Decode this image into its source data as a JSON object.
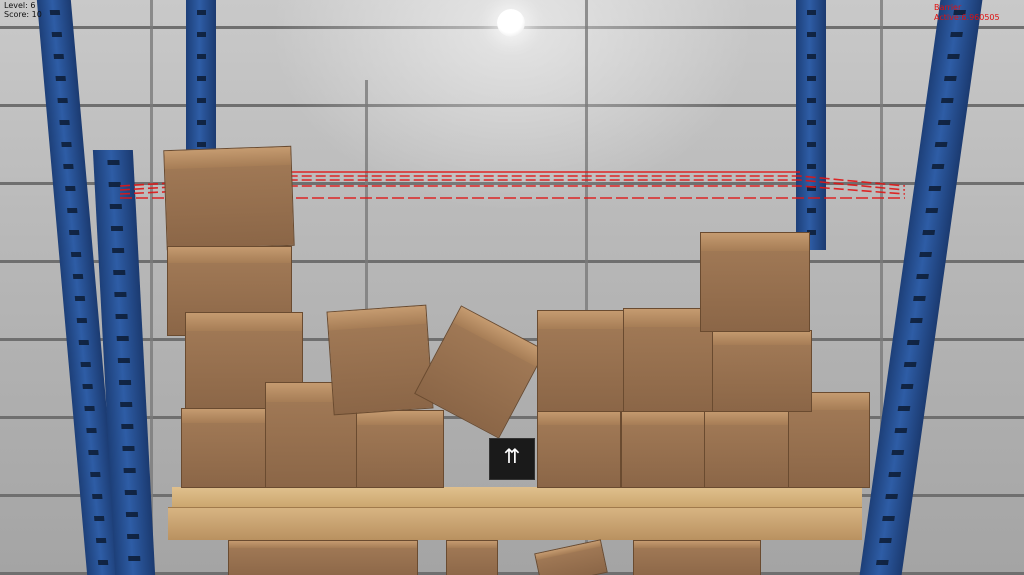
{
  "hud": {
    "level": "Level: 6",
    "score": "Score: 10",
    "barrier": "Barrier Active:6.960505"
  },
  "colors": {
    "laser": "#e01515",
    "rack": "#2e5da6",
    "box": "#9a7150",
    "shelf": "#d2ad78"
  },
  "marker": {
    "icon": "box-upright-arrows-icon",
    "glyph": "⇈"
  }
}
